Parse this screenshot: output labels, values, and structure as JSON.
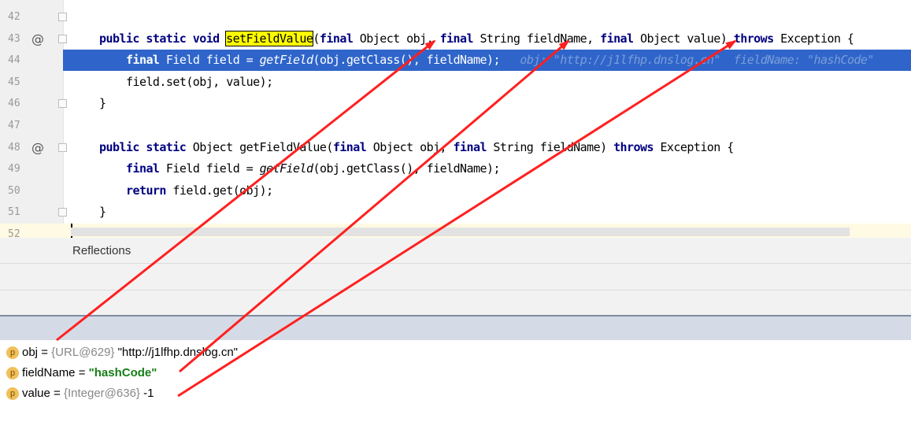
{
  "editor": {
    "lines": [
      {
        "num": "42"
      },
      {
        "num": "43",
        "annotation": "@",
        "parts": [
          {
            "t": "public static void ",
            "c": "kw"
          },
          {
            "t": "setFieldValue",
            "c": "hl-method"
          },
          {
            "t": "(",
            "c": ""
          },
          {
            "t": "final ",
            "c": "kw"
          },
          {
            "t": "Object obj, ",
            "c": ""
          },
          {
            "t": "final ",
            "c": "kw"
          },
          {
            "t": "String fieldName, ",
            "c": ""
          },
          {
            "t": "final ",
            "c": "kw"
          },
          {
            "t": "Object value) ",
            "c": ""
          },
          {
            "t": "throws ",
            "c": "kw"
          },
          {
            "t": "Exception {",
            "c": ""
          }
        ]
      },
      {
        "num": "44",
        "selected": true,
        "indent": 2,
        "parts": [
          {
            "t": "final ",
            "c": "kw"
          },
          {
            "t": "Field field = ",
            "c": ""
          },
          {
            "t": "getField",
            "c": "it"
          },
          {
            "t": "(obj.getClass(), fieldName);   ",
            "c": ""
          },
          {
            "t": "obj: \"http://j1lfhp.dnslog.cn\"  fieldName: \"hashCode\"",
            "c": "inline-hint"
          }
        ]
      },
      {
        "num": "45",
        "indent": 2,
        "parts": [
          {
            "t": "field.set(obj, value);",
            "c": ""
          }
        ]
      },
      {
        "num": "46",
        "indent": 1,
        "parts": [
          {
            "t": "}",
            "c": ""
          }
        ]
      },
      {
        "num": "47"
      },
      {
        "num": "48",
        "annotation": "@",
        "parts": [
          {
            "t": "public static ",
            "c": "kw"
          },
          {
            "t": "Object getFieldValue(",
            "c": ""
          },
          {
            "t": "final ",
            "c": "kw"
          },
          {
            "t": "Object obj, ",
            "c": ""
          },
          {
            "t": "final ",
            "c": "kw"
          },
          {
            "t": "String fieldName) ",
            "c": ""
          },
          {
            "t": "throws ",
            "c": "kw"
          },
          {
            "t": "Exception {",
            "c": ""
          }
        ]
      },
      {
        "num": "49",
        "indent": 2,
        "parts": [
          {
            "t": "final ",
            "c": "kw"
          },
          {
            "t": "Field field = ",
            "c": ""
          },
          {
            "t": "getField",
            "c": "it"
          },
          {
            "t": "(obj.getClass(), fieldName);",
            "c": ""
          }
        ]
      },
      {
        "num": "50",
        "indent": 2,
        "parts": [
          {
            "t": "return ",
            "c": "kw"
          },
          {
            "t": "field.get(obj);",
            "c": ""
          }
        ]
      },
      {
        "num": "51",
        "indent": 1,
        "parts": [
          {
            "t": "}",
            "c": ""
          }
        ]
      },
      {
        "num": "52",
        "caret": true
      }
    ]
  },
  "panel": {
    "title": "Reflections"
  },
  "variables": [
    {
      "name": "obj",
      "eq": " = ",
      "type": "{URL@629}",
      "value": " \"http://j1lfhp.dnslog.cn\"",
      "value_style": "plain"
    },
    {
      "name": "fieldName",
      "eq": " = ",
      "type": "",
      "value": "\"hashCode\"",
      "value_style": "string"
    },
    {
      "name": "value",
      "eq": " = ",
      "type": "{Integer@636}",
      "value": " -1",
      "value_style": "plain"
    }
  ],
  "badge_letter": "p",
  "colors": {
    "selection": "#2f65ca",
    "keyword": "#000080",
    "arrow": "#ff2020",
    "method_highlight": "#ffff00"
  }
}
